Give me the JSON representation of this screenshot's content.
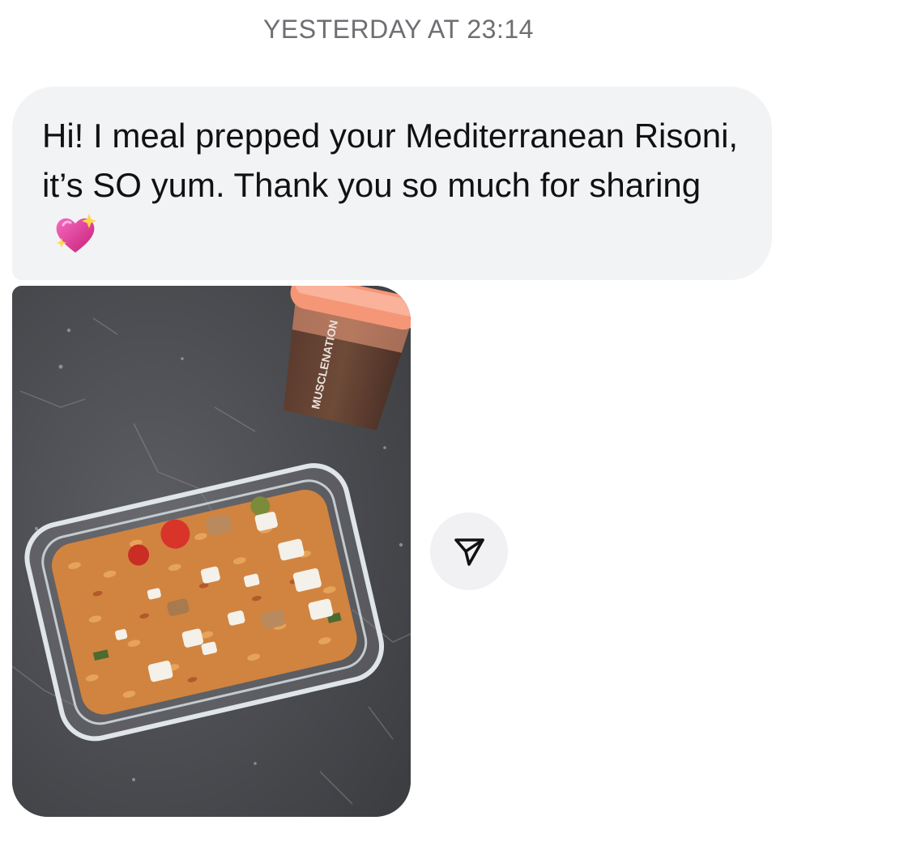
{
  "conversation": {
    "timestamp": "YESTERDAY AT 23:14",
    "message": {
      "text": "Hi! I meal prepped your Mediterranean Risoni, it’s SO yum. Thank you so much for sharing",
      "emoji": "sparkling-heart-emoji"
    },
    "photo": {
      "bottle_brand_text": "MUSCLENATION"
    },
    "share": {
      "icon": "paper-plane-icon"
    }
  },
  "colors": {
    "bubble_bg": "#f2f3f5",
    "timestamp_text": "#6e6e73",
    "share_button_bg": "#f1f1f3",
    "heart": "#e93a9a"
  }
}
